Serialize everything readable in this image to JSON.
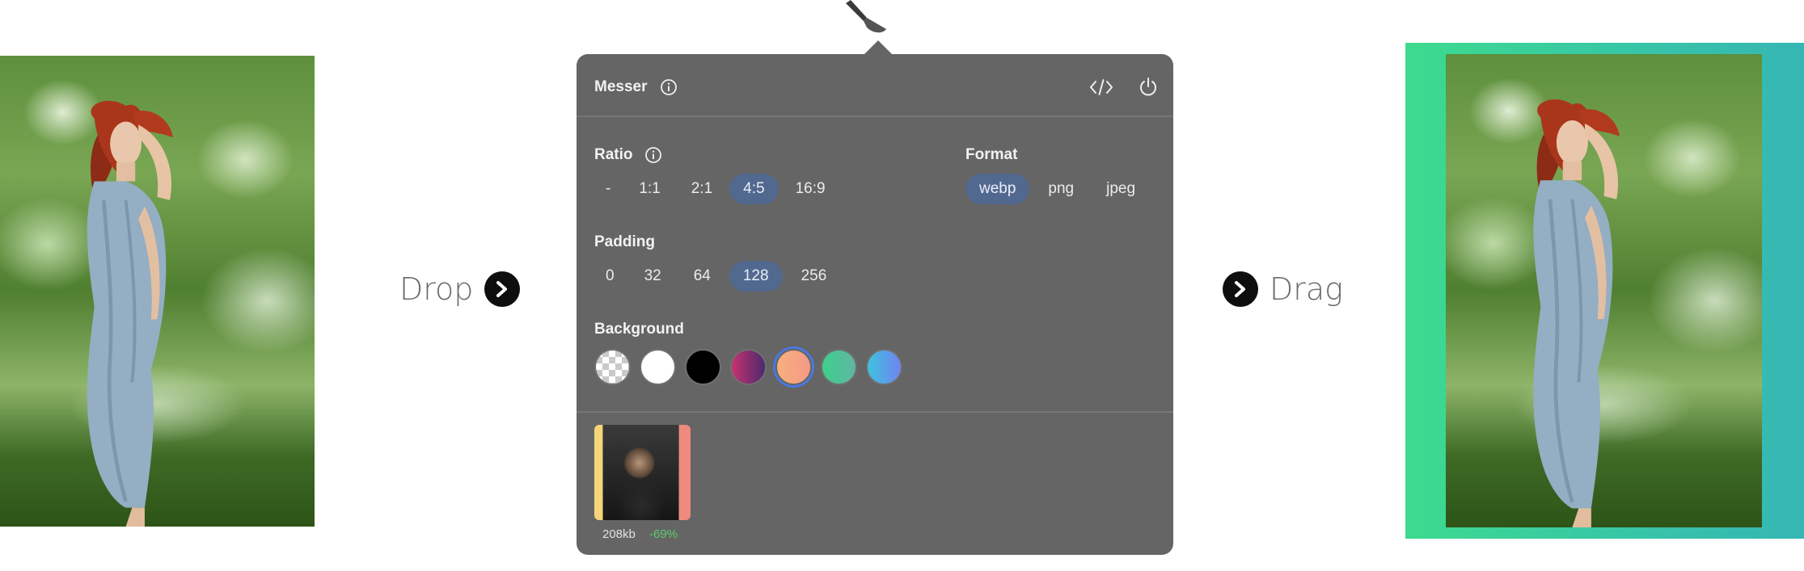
{
  "hints": {
    "drop": "Drop",
    "drag": "Drag"
  },
  "panel": {
    "title": "Messer",
    "ratio": {
      "label": "Ratio",
      "options": [
        "-",
        "1:1",
        "2:1",
        "4:5",
        "16:9"
      ],
      "selected": "4:5"
    },
    "format": {
      "label": "Format",
      "options": [
        "webp",
        "png",
        "jpeg"
      ],
      "selected": "webp"
    },
    "padding": {
      "label": "Padding",
      "options": [
        "0",
        "32",
        "64",
        "128",
        "256"
      ],
      "selected": "128"
    },
    "background": {
      "label": "Background",
      "swatches": [
        {
          "name": "transparent",
          "color": "checker"
        },
        {
          "name": "white",
          "color": "#ffffff"
        },
        {
          "name": "black",
          "color": "#000000"
        },
        {
          "name": "magenta-purple",
          "color": "linear-gradient(90deg,#c7326f,#4a2a6e)"
        },
        {
          "name": "peach-orange",
          "color": "linear-gradient(90deg,#f6b07e,#f59a85)",
          "selected": true
        },
        {
          "name": "green-teal",
          "color": "linear-gradient(90deg,#3fcf8b,#5fb7a2)"
        },
        {
          "name": "cyan-blue",
          "color": "linear-gradient(90deg,#3fc2df,#6f84f0)"
        }
      ]
    },
    "output": {
      "size": "208kb",
      "saving": "-69%"
    }
  },
  "accent": "#52698f"
}
